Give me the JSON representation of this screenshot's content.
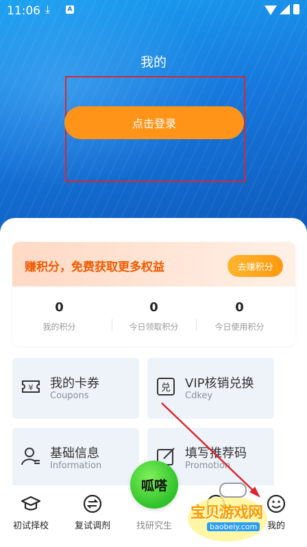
{
  "status_bar": {
    "time": "11:06"
  },
  "header": {
    "title": "我的",
    "login_label": "点击登录"
  },
  "points": {
    "headline": "赚积分，免费获取更多权益",
    "earn_button": "去赚积分",
    "stats": [
      {
        "value": "0",
        "label": "我的积分"
      },
      {
        "value": "0",
        "label": "今日领取积分"
      },
      {
        "value": "0",
        "label": "今日使用积分"
      }
    ]
  },
  "menu": [
    {
      "title": "我的卡券",
      "subtitle": "Coupons",
      "icon": "coupon-icon"
    },
    {
      "title": "VIP核销兑换",
      "subtitle": "Cdkey",
      "icon": "redeem-icon"
    },
    {
      "title": "基础信息",
      "subtitle": "Information",
      "icon": "user-info-icon"
    },
    {
      "title": "填写推荐码",
      "subtitle": "Promotion",
      "icon": "edit-icon"
    }
  ],
  "tabbar": {
    "center_badge": "呱嗒",
    "tabs": [
      {
        "label": "初试择校",
        "icon": "graduation-cap-icon"
      },
      {
        "label": "复试调剂",
        "icon": "swap-icon"
      },
      {
        "label": "找研究生",
        "icon": "none"
      },
      {
        "label": "",
        "icon": "chat-icon"
      },
      {
        "label": "我的",
        "icon": "smiley-icon"
      }
    ]
  },
  "watermark": {
    "text": "宝贝游戏网",
    "domain": "baobeiy.com"
  },
  "colors": {
    "accent_orange": "#ff9418",
    "hero_blue": "#1677dc",
    "annotation_red": "#d9272e"
  }
}
